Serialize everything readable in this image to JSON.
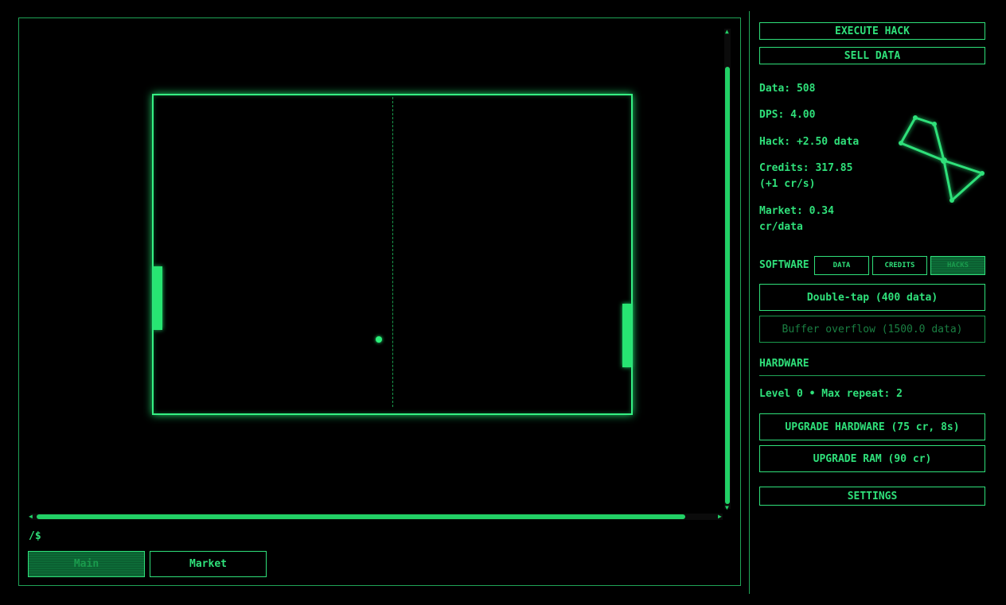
{
  "game": {
    "prompt": "/$",
    "tabs": [
      {
        "label": "Main",
        "active": true
      },
      {
        "label": "Market",
        "active": false
      }
    ]
  },
  "actions": {
    "execute_hack": "EXECUTE HACK",
    "sell_data": "SELL DATA"
  },
  "stats": {
    "data": "Data: 508",
    "dps": "DPS: 4.00",
    "hack": "Hack: +2.50 data",
    "credits": "Credits: 317.85 (+1 cr/s)",
    "market": "Market: 0.34 cr/data"
  },
  "software": {
    "label": "SOFTWARE",
    "tabs": [
      {
        "label": "DATA",
        "active": false
      },
      {
        "label": "CREDITS",
        "active": false
      },
      {
        "label": "HACKS",
        "active": true
      }
    ],
    "items": [
      {
        "label": "Double-tap (400 data)",
        "available": true
      },
      {
        "label": "Buffer overflow (1500.0 data)",
        "available": false
      }
    ]
  },
  "hardware": {
    "label": "HARDWARE",
    "status": "Level 0 • Max repeat: 2",
    "upgrade_hardware": "UPGRADE HARDWARE (75 cr, 8s)",
    "upgrade_ram": "UPGRADE RAM (90 cr)"
  },
  "settings": "SETTINGS",
  "colors": {
    "accent": "#2fe07a",
    "dim": "#1a9b4d",
    "background": "#000000"
  },
  "icons": [
    "constellation-logo-icon"
  ]
}
